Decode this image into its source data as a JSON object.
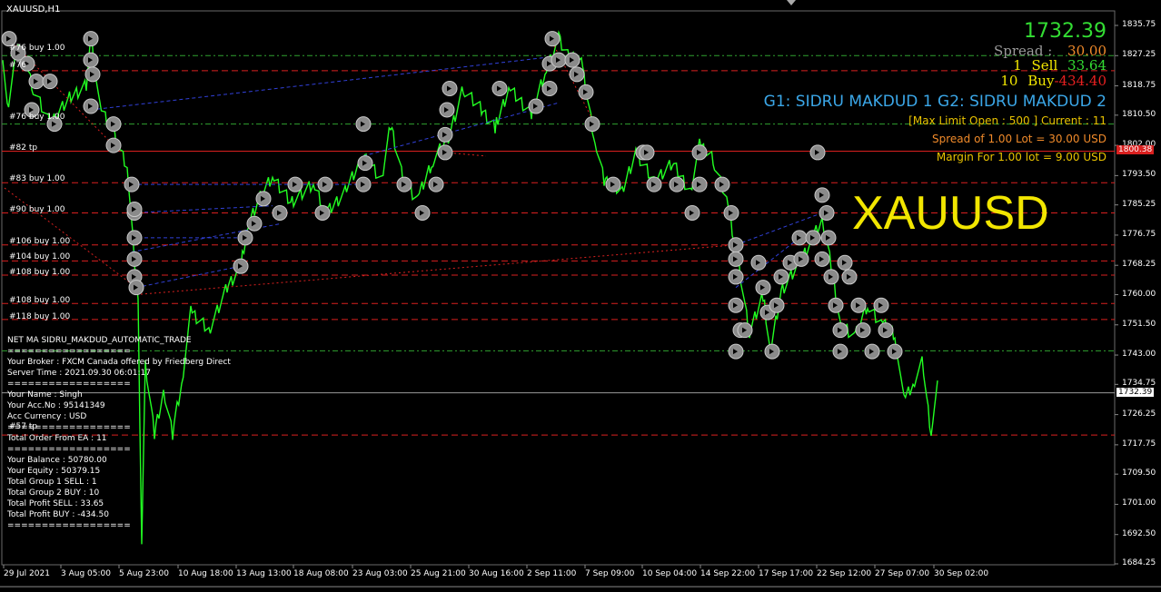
{
  "chart": {
    "symbol_label": "XAUUSD,H1",
    "watermark": "XAUUSD",
    "price_min": 1684.25,
    "price_max": 1835.75,
    "current_price": 1732.39
  },
  "overlay": {
    "price": "1732.39",
    "spread_label": "Spread :",
    "spread_value": "30.00",
    "sell_count": "1",
    "sell_label": "Sell",
    "sell_value": "33.64",
    "buy_count": "10",
    "buy_label": "Buy",
    "buy_value": "-434.40",
    "groups": "G1: SIDRU MAKDUD 1 G2: SIDRU MAKDUD 2",
    "max_limit": "[Max Limit Open :  500 ]  Current : 11",
    "spread_lot": "Spread of 1.00 Lot = 30.00  USD",
    "margin": "Margin For 1.00 lot  =  9.00  USD"
  },
  "colors": {
    "background": "#000000",
    "candles": "#22ff22",
    "line_green": "#2fa22f",
    "line_red": "#d9201f",
    "line_blue": "#3140d8",
    "marker_fill": "#8a8a8a",
    "price_green": "#33dd33",
    "accent_blue": "#3ba7e8",
    "accent_yellow": "#e8c200",
    "accent_orange": "#f08a2a"
  },
  "info_panel": [
    "NET MA SIDRU_MAKDUD_AUTOMATIC_TRADE",
    "==================",
    "Your Broker  : FXCM Canada offered by Friedberg Direct",
    "Server Time : 2021.09.30 06:01:17",
    "==================",
    "Your Name    : Singh",
    "Your Acc.No  : 95141349",
    "Acc Currency : USD",
    "==================",
    "Total Order From EA : 11",
    "==================",
    "Your Balance : 50780.00",
    "Your Equity   : 50379.15",
    "Total Group 1 SELL   :  1",
    "Total Group 2  BUY   :  10",
    "Total Profit SELL  : 33.65",
    "Total Profit  BUY  : -434.50",
    "=================="
  ],
  "order_labels": [
    {
      "text": "#76 buy 1.00",
      "price": 1828.5
    },
    {
      "text": "#76",
      "price": 1823.8
    },
    {
      "text": "#76 buy 1.00",
      "price": 1809.2
    },
    {
      "text": "#82 tp",
      "price": 1800.6
    },
    {
      "text": "#83 buy 1.00",
      "price": 1791.8
    },
    {
      "text": "#90 buy 1.00",
      "price": 1783.0
    },
    {
      "text": "#106 buy 1.00",
      "price": 1774.3
    },
    {
      "text": "#104 buy 1.00",
      "price": 1769.9
    },
    {
      "text": "#108 buy 1.00",
      "price": 1765.5
    },
    {
      "text": "#108 buy 1.00",
      "price": 1757.5
    },
    {
      "text": "#118 buy 1.00",
      "price": 1753.0
    },
    {
      "text": "#57 tp",
      "price": 1722.0
    }
  ],
  "price_axis": [
    "1835.75",
    "1827.25",
    "1818.75",
    "1810.50",
    "1802.00",
    "1793.50",
    "1785.25",
    "1776.75",
    "1768.25",
    "1760.00",
    "1751.50",
    "1743.00",
    "1734.75",
    "1726.25",
    "1717.75",
    "1709.50",
    "1701.00",
    "1692.50",
    "1684.25"
  ],
  "price_tags": [
    {
      "text": "1800.38",
      "price": 1800.38,
      "style": "red"
    },
    {
      "text": "1732.39",
      "price": 1732.39,
      "style": "cur"
    }
  ],
  "date_axis": [
    "29 Jul 2021",
    "3 Aug 05:00",
    "5 Aug 23:00",
    "10 Aug 18:00",
    "13 Aug 13:00",
    "18 Aug 08:00",
    "23 Aug 03:00",
    "25 Aug 21:00",
    "30 Aug 16:00",
    "2 Sep 11:00",
    "7 Sep 09:00",
    "10 Sep 04:00",
    "14 Sep 22:00",
    "17 Sep 17:00",
    "22 Sep 12:00",
    "27 Sep 07:00",
    "30 Sep 02:00"
  ],
  "levels": [
    {
      "price": 1827.25,
      "color": "green"
    },
    {
      "price": 1823.0,
      "color": "red"
    },
    {
      "price": 1808.0,
      "color": "green"
    },
    {
      "price": 1800.38,
      "color": "red",
      "solid": true
    },
    {
      "price": 1791.5,
      "color": "red"
    },
    {
      "price": 1783.0,
      "color": "red"
    },
    {
      "price": 1774.0,
      "color": "red"
    },
    {
      "price": 1769.5,
      "color": "red"
    },
    {
      "price": 1765.5,
      "color": "red"
    },
    {
      "price": 1757.5,
      "color": "red"
    },
    {
      "price": 1753.0,
      "color": "red"
    },
    {
      "price": 1744.2,
      "color": "green"
    },
    {
      "price": 1720.5,
      "color": "red"
    }
  ]
}
